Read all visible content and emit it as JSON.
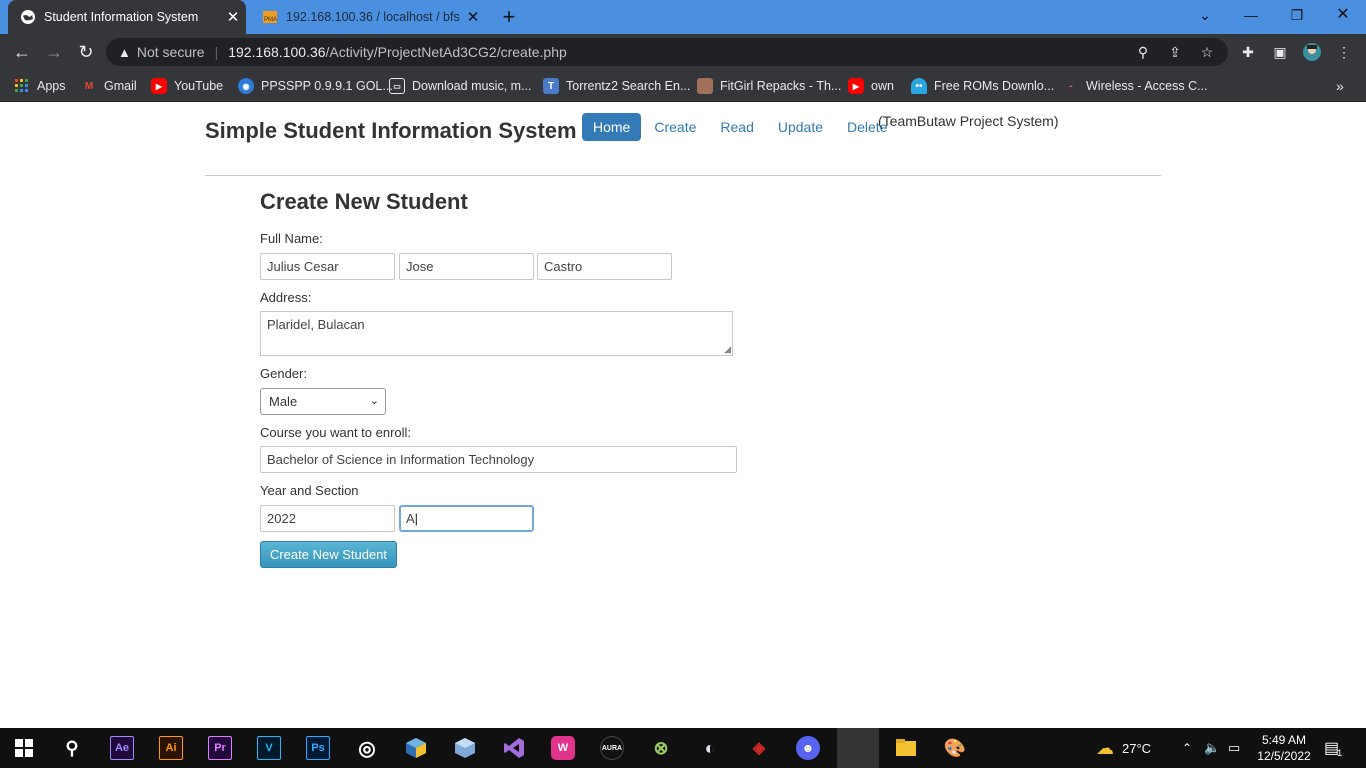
{
  "browser": {
    "tabs": [
      {
        "title": "Student Information System",
        "active": true
      },
      {
        "title": "192.168.100.36 / localhost / bfs /",
        "active": false
      }
    ],
    "omnibox": {
      "security": "Not secure",
      "host": "192.168.100.36",
      "path": "/Activity/ProjectNetAd3CG2/create.php"
    },
    "bookmarks": [
      {
        "label": "Apps",
        "icon": "apps-grid-icon"
      },
      {
        "label": "Gmail",
        "icon": "gmail-icon"
      },
      {
        "label": "YouTube",
        "icon": "youtube-icon"
      },
      {
        "label": "PPSSPP 0.9.9.1 GOL...",
        "icon": "ppsspp-icon"
      },
      {
        "label": "Download music, m...",
        "icon": "download-music-icon"
      },
      {
        "label": "Torrentz2 Search En...",
        "icon": "torrentz-icon"
      },
      {
        "label": "FitGirl Repacks - Th...",
        "icon": "fitgirl-icon"
      },
      {
        "label": "own",
        "icon": "youtube-icon"
      },
      {
        "label": "Free ROMs Downlo...",
        "icon": "roms-icon"
      },
      {
        "label": "Wireless - Access C...",
        "icon": "wireless-icon"
      }
    ]
  },
  "site": {
    "title": "Simple Student Information System",
    "nav": [
      "Home",
      "Create",
      "Read",
      "Update",
      "Delete"
    ],
    "team": "(TeamButaw Project System)"
  },
  "form": {
    "title": "Create New Student",
    "full_name_label": "Full Name:",
    "first_name": "Julius Cesar",
    "middle_name": "Jose",
    "last_name": "Castro",
    "address_label": "Address:",
    "address": "Plaridel, Bulacan",
    "gender_label": "Gender:",
    "gender": "Male",
    "course_label": "Course you want to enroll:",
    "course": "Bachelor of Science in Information Technology",
    "year_section_label": "Year and Section",
    "year": "2022",
    "section": "A",
    "submit_label": "Create New Student"
  },
  "taskbar": {
    "weather": "27°C",
    "time": "5:49 AM",
    "date": "12/5/2022",
    "notification_count": "1",
    "apps": [
      "Ae",
      "Ai",
      "Pr",
      "V",
      "Ps"
    ]
  }
}
